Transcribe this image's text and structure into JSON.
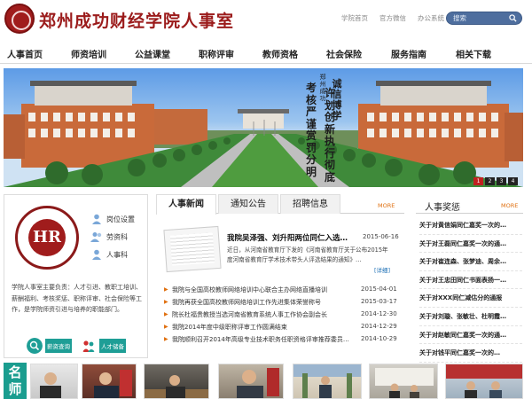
{
  "header": {
    "site_title": "郑州成功财经学院人事室",
    "top_links": [
      "学院首页",
      "官方微信",
      "办公系统"
    ],
    "search_placeholder": "搜索"
  },
  "nav": [
    "人事首页",
    "师资培训",
    "公益课堂",
    "职称评审",
    "教师资格",
    "社会保险",
    "服务指南",
    "相关下载"
  ],
  "banner": {
    "slogan_right": "诚信博学",
    "slogan_mid": "许划创新执行彻底",
    "slogan_left": "考核严谨赏罚分明",
    "slogan_small": "郑州成功",
    "slides": [
      "1",
      "2",
      "3",
      "4"
    ],
    "active_slide": 1
  },
  "hr_panel": {
    "logo_text": "HR",
    "links": [
      "岗位设置",
      "劳资科",
      "人事科"
    ],
    "description": "学院人事室主要负责：人才引进、教职工培训、薪酬福利、考核奖惩、职称评审、社会保险等工作，是学院师资引进与培养的职能部门。",
    "buttons": [
      "薪资查询",
      "人才储备"
    ]
  },
  "news": {
    "tabs": [
      "人事新闻",
      "通知公告",
      "招聘信息"
    ],
    "active_tab": 0,
    "more": "MORE",
    "feature": {
      "title": "我院吴泽强、刘升阳两位同仁入选…",
      "date": "2015-06-16",
      "summary": "近日，从河南省教育厅下发的《河南省教育厅关于公布2015年度河南省教育厅学术技术带头人评选结果的通知》…",
      "detail": "[详细]"
    },
    "items": [
      {
        "title": "我院与全国高校教师网络培训中心联合主办网络直播培训",
        "date": "2015-04-01"
      },
      {
        "title": "我院再获全国高校教师网络培训工作先进集体荣誉称号",
        "date": "2015-03-17"
      },
      {
        "title": "院长杜福贵教授当选河南省教育系统人事工作协会副会长",
        "date": "2014-12-30"
      },
      {
        "title": "我院2014年度中级职称评审工作圆满结束",
        "date": "2014-12-29"
      },
      {
        "title": "我院顺利召开2014年高级专业技术职务任职资格评审推荐委员…",
        "date": "2014-10-29"
      }
    ]
  },
  "awards": {
    "title": "人事奖惩",
    "more": "MORE",
    "items": [
      "关于对黄信娟同仁嘉奖一次的…",
      "关于对王磊同仁嘉奖一次的通…",
      "关于对崔连森、张梦迪、周余…",
      "关于对王忠田同仁书面表扬一…",
      "关于对XXX同仁减估分的通报",
      "关于对刘璇、张敏壮、杜明霞…",
      "关于对赵敏同仁嘉奖一次的通…",
      "关于对钱平同仁嘉奖一次的…"
    ]
  },
  "famous": {
    "label": "名师风采"
  },
  "colors": {
    "brand_red": "#9b1b1b",
    "search_blue": "#4e6e9e",
    "teal": "#1a9d8f",
    "more_orange": "#e07010"
  }
}
